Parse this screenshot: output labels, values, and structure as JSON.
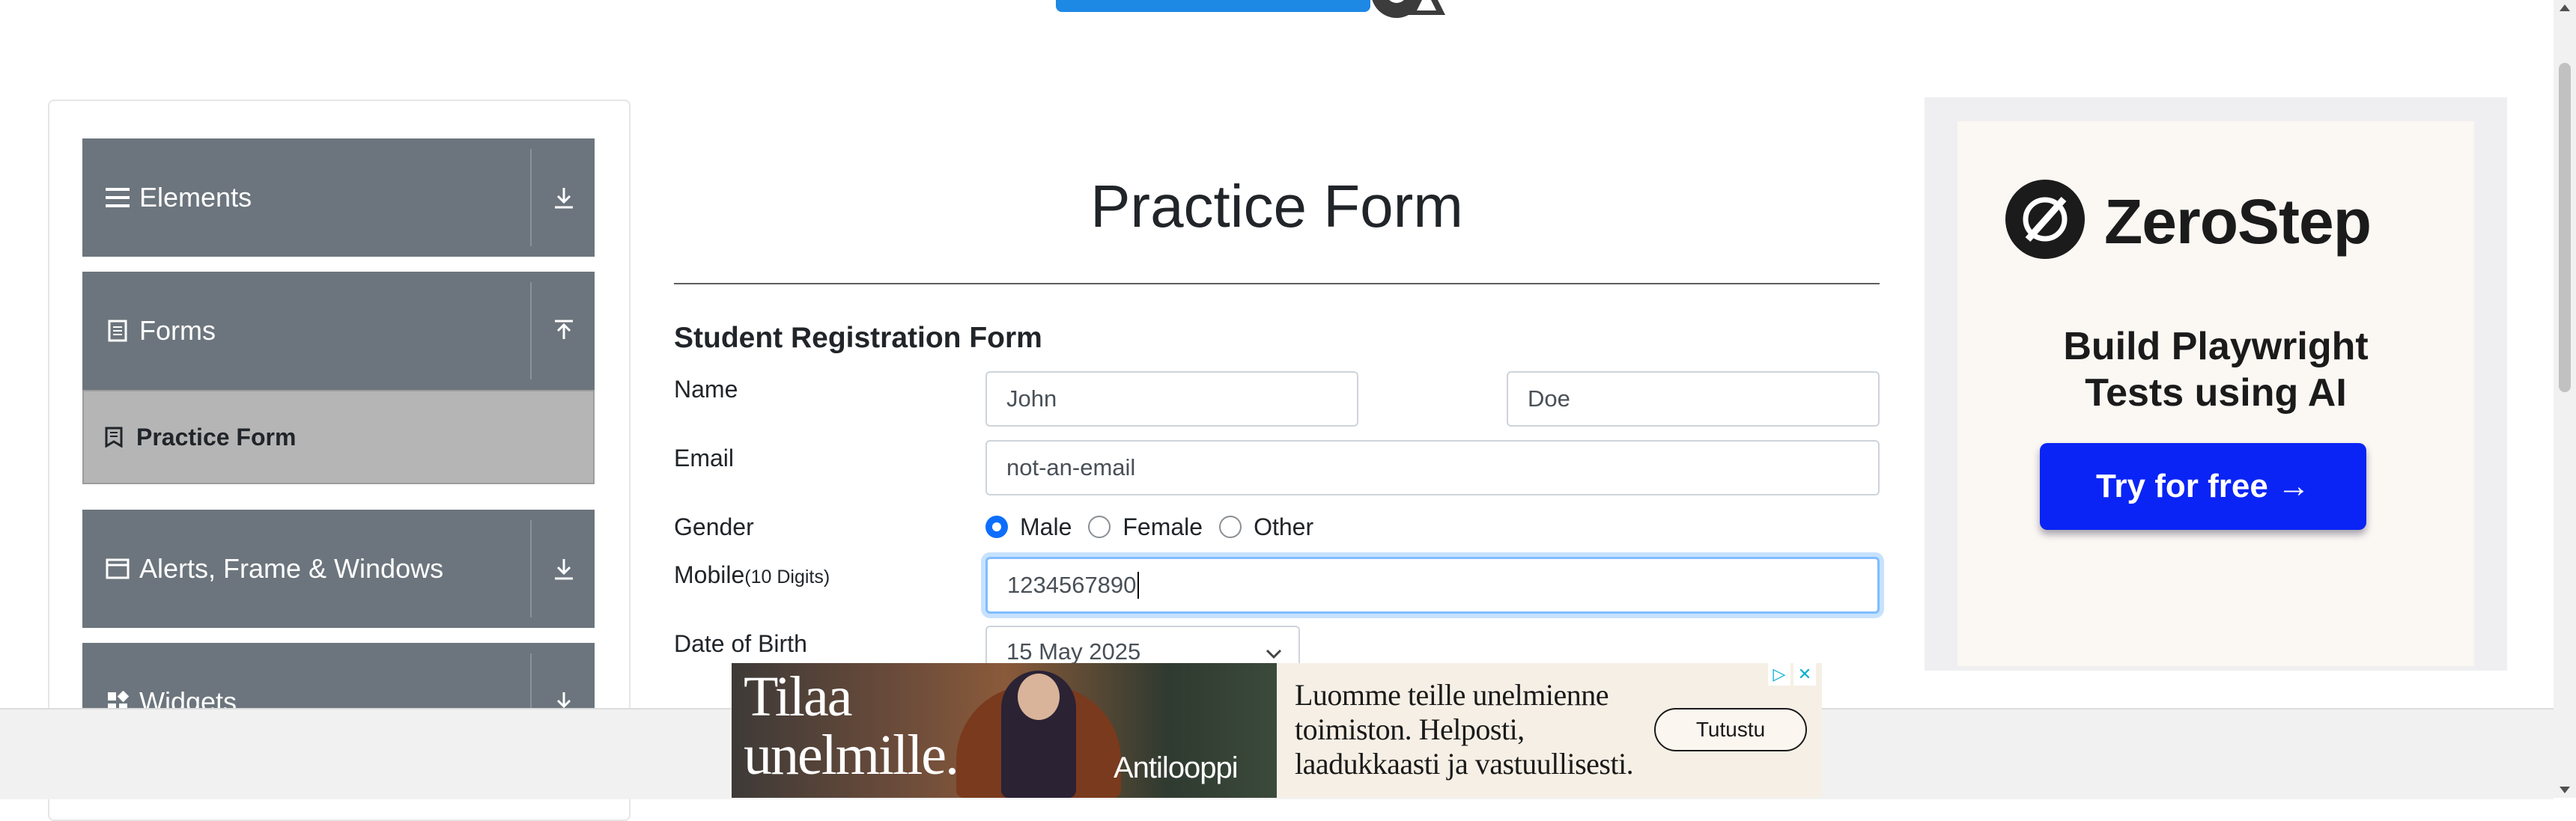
{
  "header": {
    "logo_alt": "TOOLSQA"
  },
  "sidebar": {
    "groups": [
      {
        "label": "Elements",
        "icon": "hamburger-icon",
        "arrow": "download-icon"
      },
      {
        "label": "Forms",
        "icon": "document-icon",
        "arrow": "upload-icon"
      },
      {
        "label": "Alerts, Frame & Windows",
        "icon": "window-icon",
        "arrow": "download-icon"
      },
      {
        "label": "Widgets",
        "icon": "widgets-icon",
        "arrow": "download-icon"
      }
    ],
    "active_item": "Practice Form"
  },
  "form": {
    "title": "Practice Form",
    "subtitle": "Student Registration Form",
    "name_label": "Name",
    "first_name": "John",
    "last_name": "Doe",
    "email_label": "Email",
    "email_value": "not-an-email",
    "gender_label": "Gender",
    "gender_options": [
      "Male",
      "Female",
      "Other"
    ],
    "gender_selected": "Male",
    "mobile_label": "Mobile",
    "mobile_hint": "(10 Digits)",
    "mobile_value": "1234567890",
    "dob_label": "Date of Birth",
    "dob_value": "15 May 2025"
  },
  "ad_right": {
    "brand": "ZeroStep",
    "tagline_line1": "Build Playwright",
    "tagline_line2": "Tests using AI",
    "cta": "Try for free →"
  },
  "ad_bottom": {
    "headline_line1": "Tilaa",
    "headline_line2": "unelmille.",
    "brand": "Antilooppi",
    "copy": "Luomme teille unelmienne toimiston. Helposti, laadukkaasti ja vastuullisesti.",
    "cta": "Tutustu"
  },
  "colors": {
    "sidebar_group": "#6c757d",
    "active_item": "#b5b5b5",
    "accent": "#0d6efd",
    "cta_blue": "#0a24f5"
  }
}
